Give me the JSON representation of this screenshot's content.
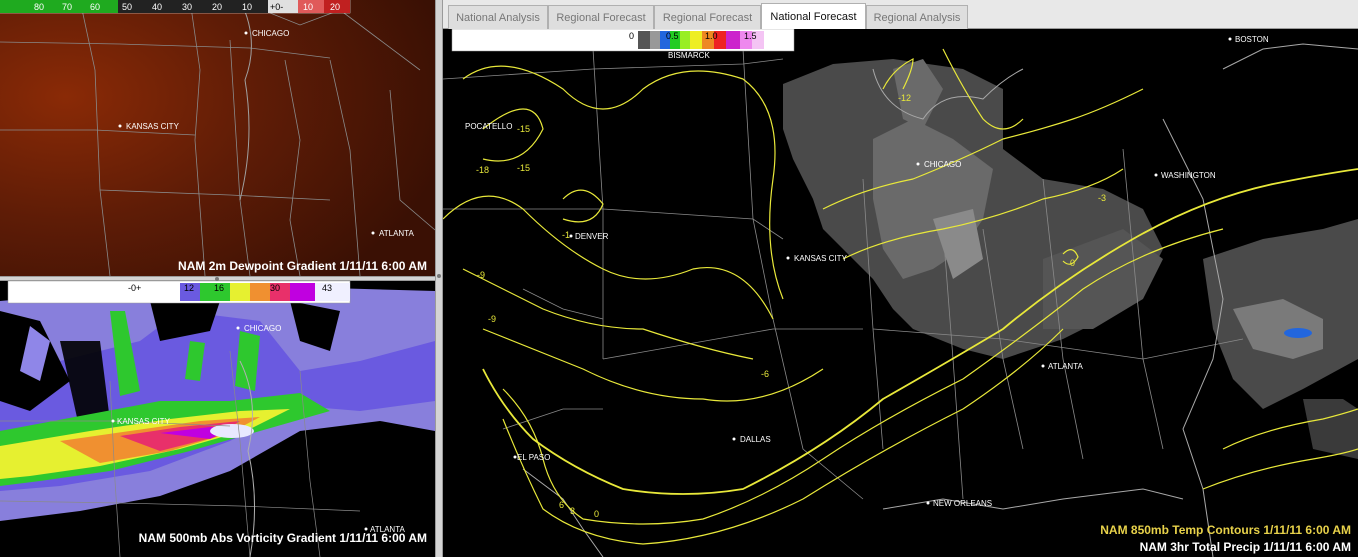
{
  "tabs": [
    {
      "label": "National Analysis",
      "active": false
    },
    {
      "label": "Regional Forecast",
      "active": false
    },
    {
      "label": "Regional Forecast",
      "active": false
    },
    {
      "label": "National Forecast",
      "active": true
    },
    {
      "label": "Regional Analysis",
      "active": false
    }
  ],
  "dewpoint_panel": {
    "title": "NAM 2m Dewpoint Gradient 1/11/11 6:00 AM",
    "colorbar_labels": [
      "80",
      "70",
      "60",
      "50",
      "40",
      "30",
      "20",
      "10",
      "+0-",
      "10",
      "20"
    ],
    "cities": [
      "CHICAGO",
      "KANSAS CITY",
      "ATLANTA"
    ]
  },
  "vorticity_panel": {
    "title": "NAM 500mb Abs Vorticity Gradient 1/11/11 6:00 AM",
    "colorbar_labels": [
      "-0+",
      "12",
      "16",
      "30",
      "43"
    ],
    "cities": [
      "CHICAGO",
      "KANSAS CITY",
      "ATLANTA"
    ]
  },
  "main_panel": {
    "title_temp": "NAM 850mb Temp Contours 1/11/11 6:00 AM",
    "title_precip": "NAM 3hr Total Precip 1/11/11 6:00 AM",
    "colorbar_labels": [
      "0",
      "0.5",
      "1.0",
      "1.5"
    ],
    "cities": [
      "BOSTON",
      "CHICAGO",
      "WASHINGTON",
      "DENVER",
      "KANSAS CITY",
      "ATLANTA",
      "DALLAS",
      "EL PASO",
      "NEW ORLEANS",
      "POCATELLO",
      "BISMARCK"
    ],
    "contour_labels": [
      "-12",
      "-15",
      "-15",
      "-18",
      "-1",
      "-9",
      "-9",
      "-6",
      "-3",
      "0",
      "6",
      "3",
      "0"
    ]
  },
  "colors": {
    "contour": "#e8e83a",
    "temp_title": "#e8d24a",
    "dewpoint_bg": "#5a1a06",
    "map_lines": "#8a8a8a"
  }
}
